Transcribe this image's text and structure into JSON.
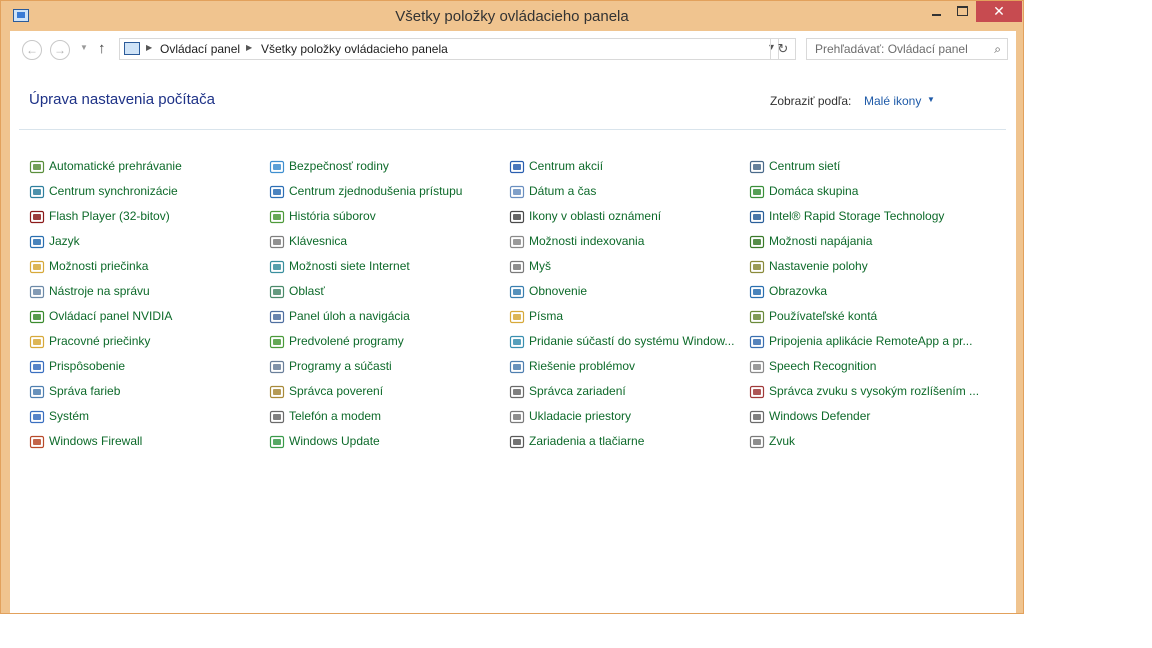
{
  "window": {
    "title": "Všetky položky ovládacieho panela",
    "accent": "#f0c48f",
    "close_color": "#c74b50"
  },
  "nav": {
    "back_icon": "back-arrow-icon",
    "forward_icon": "forward-arrow-icon",
    "up_icon": "up-arrow-icon",
    "breadcrumbs": [
      "Ovládací panel",
      "Všetky položky ovládacieho panela"
    ],
    "search_placeholder": "Prehľadávať: Ovládací panel"
  },
  "header": {
    "title": "Úprava nastavenia počítača",
    "view_by_label": "Zobraziť podľa:",
    "view_by_value": "Malé ikony"
  },
  "items": [
    [
      "Automatické prehrávanie",
      "Centrum synchronizácie",
      "Flash Player (32-bitov)",
      "Jazyk",
      "Možnosti priečinka",
      "Nástroje na správu",
      "Ovládací panel NVIDIA",
      "Pracovné priečinky",
      "Prispôsobenie",
      "Správa farieb",
      "Systém",
      "Windows Firewall"
    ],
    [
      "Bezpečnosť rodiny",
      "Centrum zjednodušenia prístupu",
      "História súborov",
      "Klávesnica",
      "Možnosti siete Internet",
      "Oblasť",
      "Panel úloh a navigácia",
      "Predvolené programy",
      "Programy a súčasti",
      "Správca poverení",
      "Telefón a modem",
      "Windows Update"
    ],
    [
      "Centrum akcií",
      "Dátum a čas",
      "Ikony v oblasti oznámení",
      "Možnosti indexovania",
      "Myš",
      "Obnovenie",
      "Písma",
      "Pridanie súčastí do systému Window...",
      "Riešenie problémov",
      "Správca zariadení",
      "Ukladacie priestory",
      "Zariadenia a tlačiarne"
    ],
    [
      "Centrum sietí",
      "Domáca skupina",
      "Intel® Rapid Storage Technology",
      "Možnosti napájania",
      "Nastavenie polohy",
      "Obrazovka",
      "Používateľské kontá",
      "Pripojenia aplikácie RemoteApp a pr...",
      "Speech Recognition",
      "Správca zvuku s vysokým rozlíšením ...",
      "Windows Defender",
      "Zvuk"
    ]
  ],
  "item_color": "#0d6a2a",
  "title_color": "#1e3287"
}
